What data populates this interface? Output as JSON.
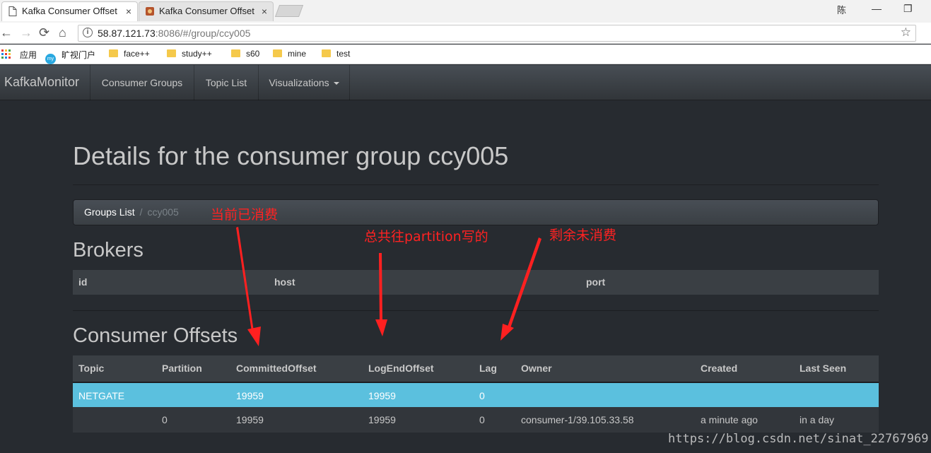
{
  "browser": {
    "tabs": [
      {
        "title": "Kafka Consumer Offset",
        "close": "×"
      },
      {
        "title": "Kafka Consumer Offset",
        "close": "×"
      }
    ],
    "window_controls": {
      "user": "陈",
      "minimize": "—",
      "restore": "❐"
    },
    "nav": {
      "back": "←",
      "forward": "→",
      "reload": "⟳",
      "home": "⌂"
    },
    "url": {
      "host": "58.87.121.73",
      "rest": ":8086/#/group/ccy005"
    },
    "bookmarks": [
      "应用",
      "旷视门户",
      "face++",
      "study++",
      "s60",
      "mine",
      "test"
    ]
  },
  "navbar": {
    "brand": "KafkaMonitor",
    "items": [
      "Consumer Groups",
      "Topic List",
      "Visualizations"
    ]
  },
  "page": {
    "title": "Details for the consumer group ccy005",
    "breadcrumb": {
      "link": "Groups List",
      "separator": "/",
      "current": "ccy005"
    }
  },
  "brokers": {
    "heading": "Brokers",
    "columns": [
      "id",
      "host",
      "port"
    ]
  },
  "offsets": {
    "heading": "Consumer Offsets",
    "columns": [
      "Topic",
      "Partition",
      "CommittedOffset",
      "LogEndOffset",
      "Lag",
      "Owner",
      "Created",
      "Last Seen"
    ],
    "topic_row": {
      "topic": "NETGATE",
      "committed": "19959",
      "logend": "19959",
      "lag": "0"
    },
    "partition_row": {
      "partition": "0",
      "committed": "19959",
      "logend": "19959",
      "lag": "0",
      "owner": "consumer-1/39.105.33.58",
      "created": "a minute ago",
      "last_seen": "in a day"
    }
  },
  "annotations": {
    "consumed": "当前已消费",
    "total": "总共往partition写的",
    "remaining": "剩余未消费"
  },
  "watermark": "https://blog.csdn.net/sinat_22767969",
  "colors": {
    "accent_row": "#5bc0de",
    "annotation": "#ff2222",
    "background": "#272b30"
  }
}
